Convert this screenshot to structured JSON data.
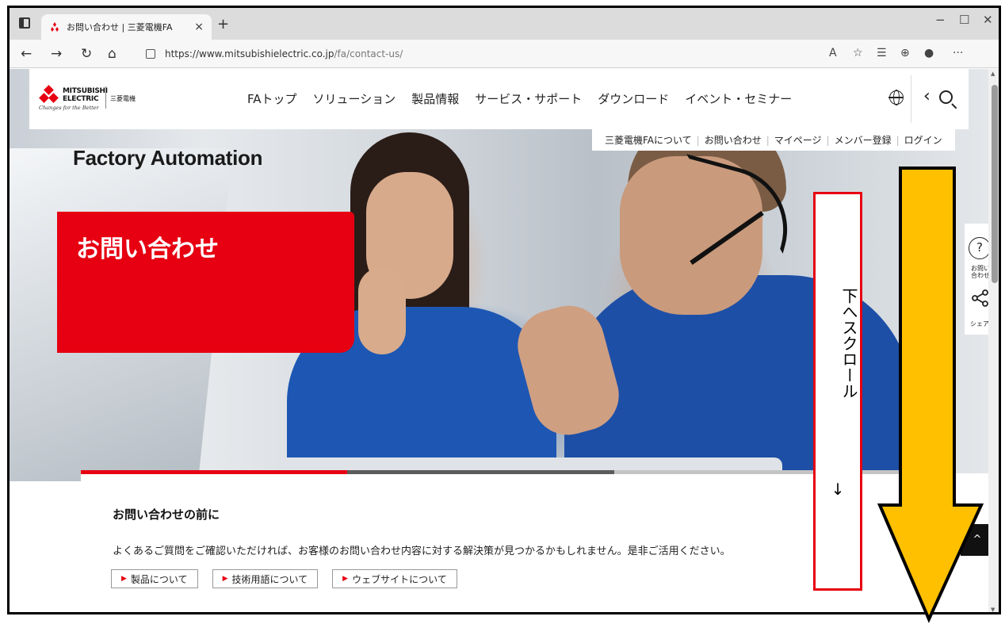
{
  "browser": {
    "tab_title": "お問い合わせ | 三菱電機FA",
    "tab_close": "×",
    "new_tab": "+",
    "url_host": "https://www.mitsubishielectric.co.jp",
    "url_path": "/fa/contact-us/",
    "window_controls": [
      "−",
      "☐",
      "✕"
    ],
    "nav_icons": [
      "back-icon",
      "forward-icon",
      "refresh-icon",
      "home-icon"
    ]
  },
  "site": {
    "logo_brand_line1": "MITSUBISHI",
    "logo_brand_line2": "ELECTRIC",
    "logo_tagline": "Changes for the Better",
    "logo_jp": "三菱電機",
    "global_nav": [
      "FAトップ",
      "ソリューション",
      "製品情報",
      "サービス・サポート",
      "ダウンロード",
      "イベント・セミナー"
    ],
    "sub_nav": [
      "三菱電機FAについて",
      "お問い合わせ",
      "マイページ",
      "メンバー登録",
      "ログイン"
    ]
  },
  "hero": {
    "site_title": "Factory Automation",
    "page_title": "お問い合わせ"
  },
  "content": {
    "heading": "お問い合わせの前に",
    "lead": "よくあるご質問をご確認いただければ、お客様のお問い合わせ内容に対する解決策が見つかるかもしれません。是非ご活用ください。",
    "buttons": [
      "製品について",
      "技術用語について",
      "ウェブサイトについて"
    ]
  },
  "side_panel": {
    "contact_label": "お問い合わせ",
    "share_label": "シェア",
    "page_top": "^"
  },
  "annotation": {
    "text": "下へスクロール",
    "arrow": "↓",
    "box_color": "#e60012",
    "arrow_color": "#ffc000"
  },
  "colors": {
    "brand_red": "#e60012"
  }
}
